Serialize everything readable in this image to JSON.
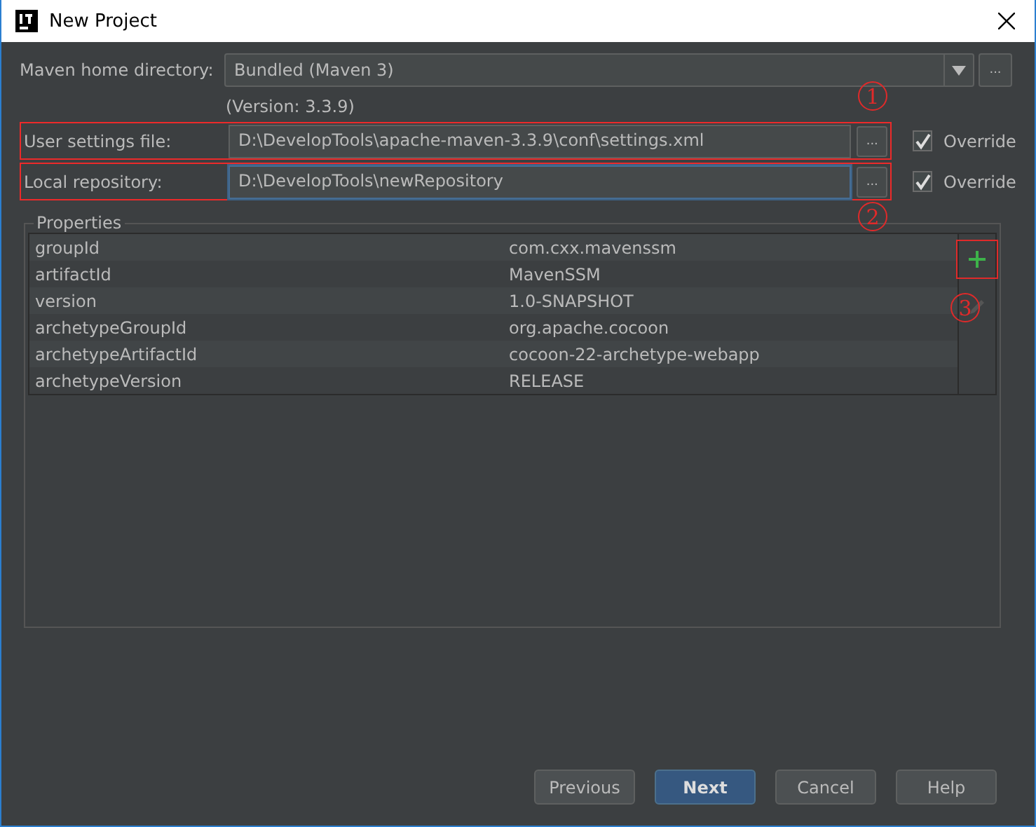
{
  "window": {
    "title": "New Project"
  },
  "maven_home": {
    "label": "Maven home directory:",
    "value": "Bundled (Maven 3)",
    "version": "(Version: 3.3.9)",
    "browse_label": "..."
  },
  "settings_rows": [
    {
      "label": "User settings file:",
      "value": "D:\\DevelopTools\\apache-maven-3.3.9\\conf\\settings.xml",
      "focused": false,
      "browse_label": "...",
      "override_label": "Override",
      "override": true,
      "highlighted": true,
      "annotation": "1"
    },
    {
      "label": "Local repository:",
      "value": "D:\\DevelopTools\\newRepository",
      "focused": true,
      "browse_label": "...",
      "override_label": "Override",
      "override": true,
      "highlighted": true,
      "annotation": "2"
    }
  ],
  "properties": {
    "title": "Properties",
    "rows": [
      {
        "name": "groupId",
        "value": "com.cxx.mavenssm"
      },
      {
        "name": "artifactId",
        "value": "MavenSSM"
      },
      {
        "name": "version",
        "value": "1.0-SNAPSHOT"
      },
      {
        "name": "archetypeGroupId",
        "value": "org.apache.cocoon"
      },
      {
        "name": "archetypeArtifactId",
        "value": "cocoon-22-archetype-webapp"
      },
      {
        "name": "archetypeVersion",
        "value": "RELEASE"
      }
    ],
    "tools": [
      {
        "kind": "add",
        "disabled": false,
        "highlighted": true
      },
      {
        "kind": "edit",
        "disabled": true,
        "highlighted": false,
        "annotation": "3"
      }
    ]
  },
  "buttons": [
    {
      "label": "Previous",
      "default": false
    },
    {
      "label": "Next",
      "default": true
    },
    {
      "label": "Cancel",
      "default": false
    },
    {
      "label": "Help",
      "default": false
    }
  ]
}
